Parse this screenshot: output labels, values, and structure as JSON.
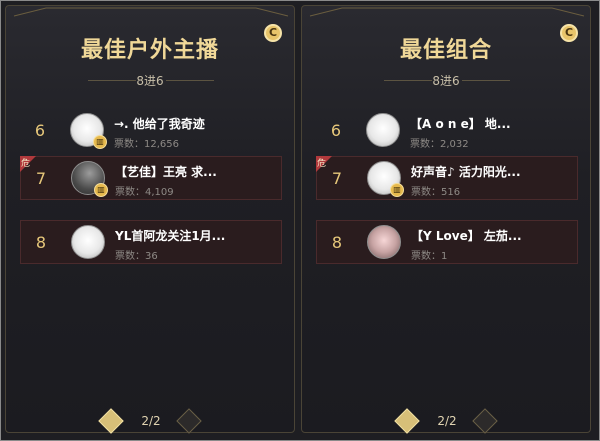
{
  "colors": {
    "panel_bg": "#1f1f24",
    "title_gold": "#f0d898",
    "rank_gold": "#e6c77a",
    "danger_red": "#b0393c"
  },
  "panels": [
    {
      "title": "最佳户外主播",
      "subtitle": "8进6",
      "icon": "coin-icon",
      "rows": [
        {
          "rank": "6",
          "name": "→. 他给了我奇迹",
          "votes": "票数：12,656",
          "highlight": false,
          "danger": "",
          "avatar": "white"
        },
        {
          "rank": "7",
          "name": "【艺佳】王亮 求...",
          "votes": "票数：4,109",
          "highlight": true,
          "danger": "危",
          "avatar": "dark"
        },
        {
          "rank": "8",
          "name": "YL首阿龙关注1月...",
          "votes": "票数：36",
          "highlight": true,
          "danger": "",
          "avatar": "white"
        }
      ],
      "pager": {
        "text": "2/2"
      }
    },
    {
      "title": "最佳组合",
      "subtitle": "8进6",
      "icon": "coin-icon",
      "rows": [
        {
          "rank": "6",
          "name": "【A o n e】 地...",
          "votes": "票数：2,032",
          "highlight": false,
          "danger": "",
          "avatar": "white"
        },
        {
          "rank": "7",
          "name": "好声音♪ 活力阳光...",
          "votes": "票数：516",
          "highlight": true,
          "danger": "危",
          "avatar": "white"
        },
        {
          "rank": "8",
          "name": "【Y Love】 左茄...",
          "votes": "票数：1",
          "highlight": true,
          "danger": "",
          "avatar": "pink"
        }
      ],
      "pager": {
        "text": "2/2"
      }
    }
  ]
}
